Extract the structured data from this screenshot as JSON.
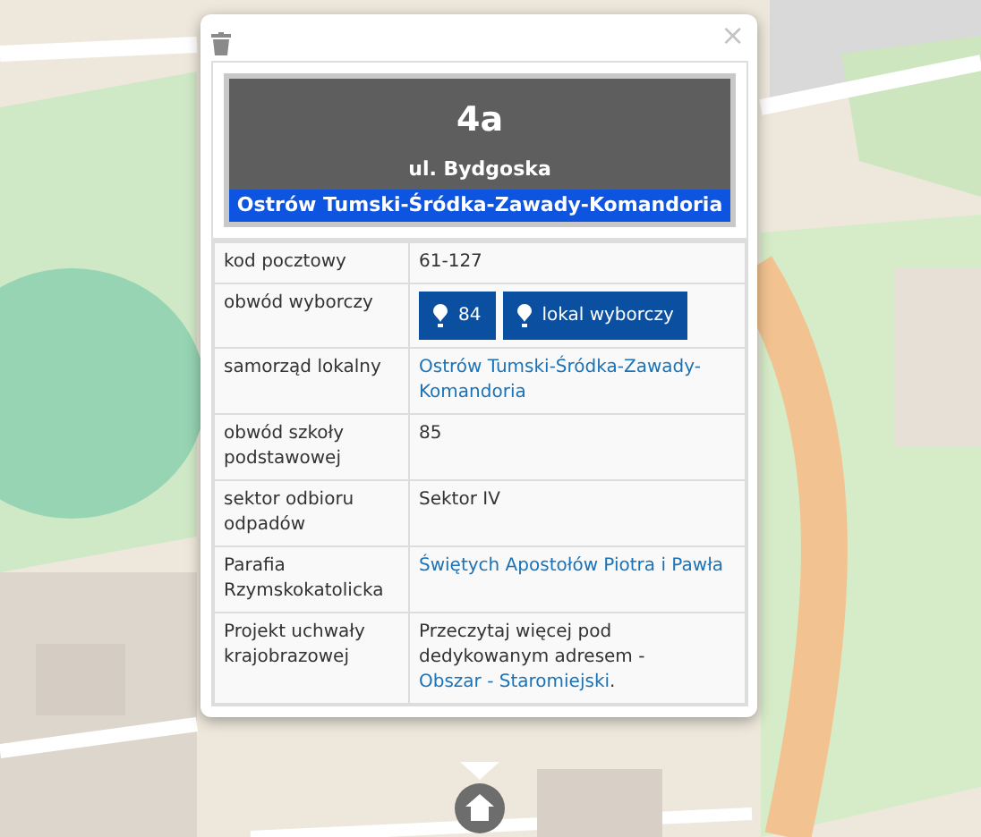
{
  "popup": {
    "close": "×",
    "header": {
      "number": "4a",
      "street": "ul. Bydgoska",
      "district": "Ostrów Tumski-Śródka-Zawady-Komandoria"
    },
    "rows": [
      {
        "label": "kod pocztowy",
        "kind": "text",
        "parts": [
          {
            "text": "61-127",
            "link": false
          }
        ]
      },
      {
        "label": "obwód wyborczy",
        "kind": "buttons",
        "buttons": [
          "84",
          "lokal wyborczy"
        ]
      },
      {
        "label": "samorząd lokalny",
        "kind": "text",
        "parts": [
          {
            "text": "Ostrów Tumski-Śródka-Zawady-Komandoria",
            "link": true
          }
        ]
      },
      {
        "label": "obwód szkoły podstawowej",
        "kind": "text",
        "parts": [
          {
            "text": "85",
            "link": false
          }
        ]
      },
      {
        "label": "sektor odbioru odpadów",
        "kind": "text",
        "parts": [
          {
            "text": "Sektor IV",
            "link": false
          }
        ]
      },
      {
        "label": "Parafia Rzymskokatolicka",
        "kind": "text",
        "parts": [
          {
            "text": "Świętych Apostołów Piotra i Pawła",
            "link": true
          }
        ]
      },
      {
        "label": "Projekt uchwały krajobrazowej",
        "kind": "text",
        "parts": [
          {
            "text": "Przeczytaj więcej pod dedykowanym adresem - ",
            "link": false
          },
          {
            "text": "Obszar - Staromiejski",
            "link": true
          },
          {
            "text": ".",
            "link": false
          }
        ]
      }
    ]
  }
}
